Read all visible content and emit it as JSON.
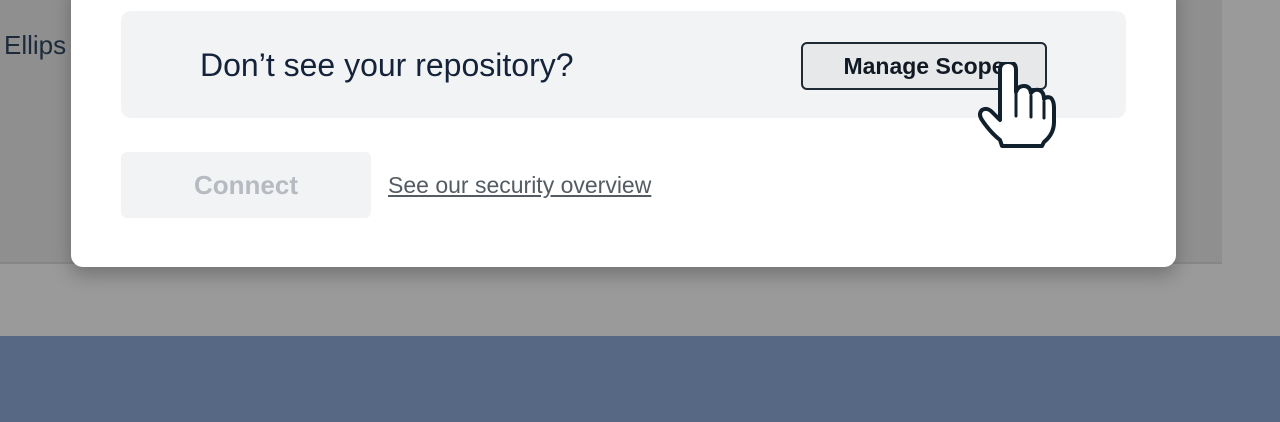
{
  "background": {
    "partial_text": "Ellips",
    "overlay_color": "#9a9a9a",
    "footer_color": "#566883"
  },
  "modal": {
    "scope_question": "Don’t see your repository?",
    "manage_scope_label": "Manage Scope",
    "connect_label": "Connect",
    "connect_disabled": true,
    "security_link_text": "See our security overview"
  },
  "cursor": {
    "icon": "hand-pointer-icon"
  }
}
